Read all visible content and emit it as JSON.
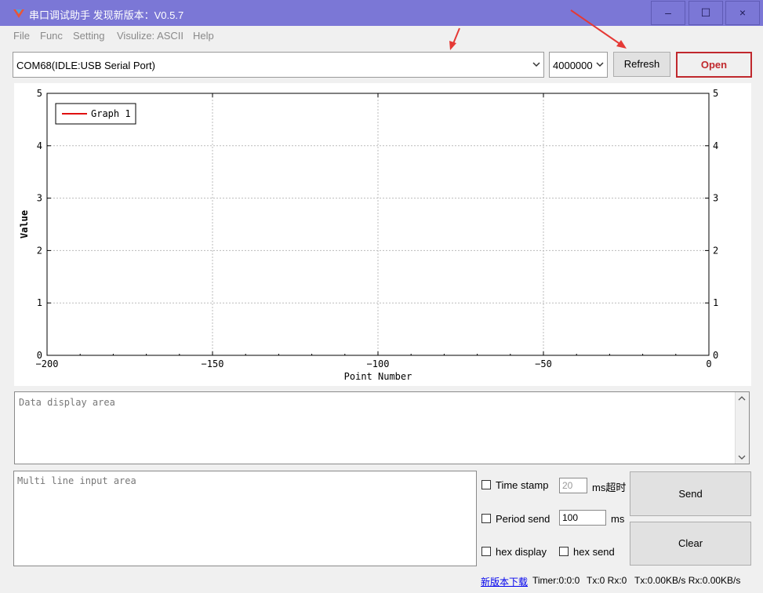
{
  "window": {
    "title": "串口调试助手 发现新版本：V0.5.7",
    "minimize_symbol": "–",
    "maximize_symbol": "☐",
    "close_symbol": "×"
  },
  "menu": [
    "File",
    "Func",
    "Setting",
    "Visulize: ASCII",
    "Help"
  ],
  "toolbar": {
    "port_value": "COM68(IDLE:USB Serial Port)",
    "baud_value": "4000000",
    "refresh_label": "Refresh",
    "open_label": "Open"
  },
  "colors": {
    "titlebar": "#7b77d6",
    "open_text": "#c0282d",
    "series": "#e01010",
    "annotation_arrow": "#e53935"
  },
  "chart_data": {
    "type": "line",
    "title": "",
    "xlabel": "Point Number",
    "ylabel": "Value",
    "xlim": [
      -200,
      0
    ],
    "ylim": [
      0,
      5
    ],
    "x_ticks": [
      "−200",
      "−150",
      "−100",
      "−50",
      "0"
    ],
    "x_tick_values": [
      -200,
      -150,
      -100,
      -50,
      0
    ],
    "y_ticks": [
      "0",
      "1",
      "2",
      "3",
      "4",
      "5"
    ],
    "y_tick_values": [
      0,
      1,
      2,
      3,
      4,
      5
    ],
    "grid": true,
    "legend_position": "top-left",
    "series": [
      {
        "name": "Graph 1",
        "x": [],
        "values": []
      }
    ]
  },
  "display": {
    "placeholder": "Data display area"
  },
  "input": {
    "placeholder": "Multi line input area"
  },
  "options": {
    "timestamp_label": "Time stamp",
    "timeout_value": "20",
    "timeout_unit": "ms超时",
    "period_label": "Period send",
    "period_value": "100",
    "period_unit": "ms",
    "hex_display_label": "hex display",
    "hex_send_label": "hex send"
  },
  "buttons": {
    "send_label": "Send",
    "clear_label": "Clear"
  },
  "statusbar": {
    "download_link": "新版本下载",
    "timer": "Timer:0:0:0",
    "counts": "Tx:0 Rx:0",
    "rates": "Tx:0.00KB/s Rx:0.00KB/s"
  }
}
